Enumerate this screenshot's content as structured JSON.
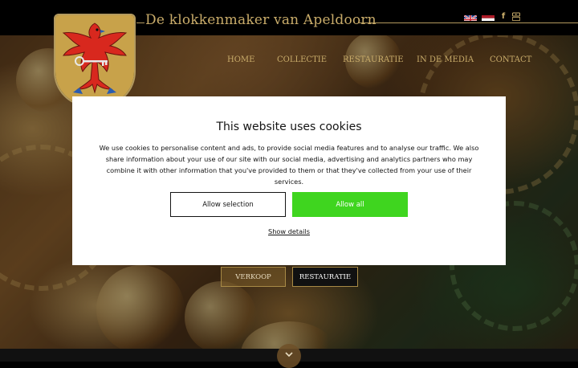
{
  "header": {
    "site_title": "De klokkenmaker van Apeldoorn",
    "crest_icon": "coat-of-arms-eagle-key-icon",
    "accent_color": "#c9ac6a"
  },
  "top_icons": [
    {
      "name": "uk-flag-icon",
      "label": "English"
    },
    {
      "name": "nl-flag-icon",
      "label": "Nederlands"
    },
    {
      "name": "facebook-icon",
      "glyph": "f"
    },
    {
      "name": "youtube-icon",
      "glyph": "▶"
    }
  ],
  "nav": {
    "items": [
      "HOME",
      "COLLECTIE",
      "RESTAURATIE",
      "IN DE MEDIA",
      "CONTACT"
    ]
  },
  "hero": {
    "buttons": {
      "verkoop": "VERKOOP",
      "restauratie": "RESTAURATIE"
    },
    "scroll_icon": "chevron-down-icon"
  },
  "cookie_banner": {
    "title": "This website uses cookies",
    "text": "We use cookies to personalise content and ads, to provide social media features and to analyse our traffic. We also share information about your use of our site with our social media, advertising and analytics partners who may combine it with other information that you've provided to them or that they've collected from your use of their services.",
    "allow_selection": "Allow selection",
    "allow_all": "Allow all",
    "show_details": "Show details",
    "allow_all_color": "#3fd51f"
  }
}
